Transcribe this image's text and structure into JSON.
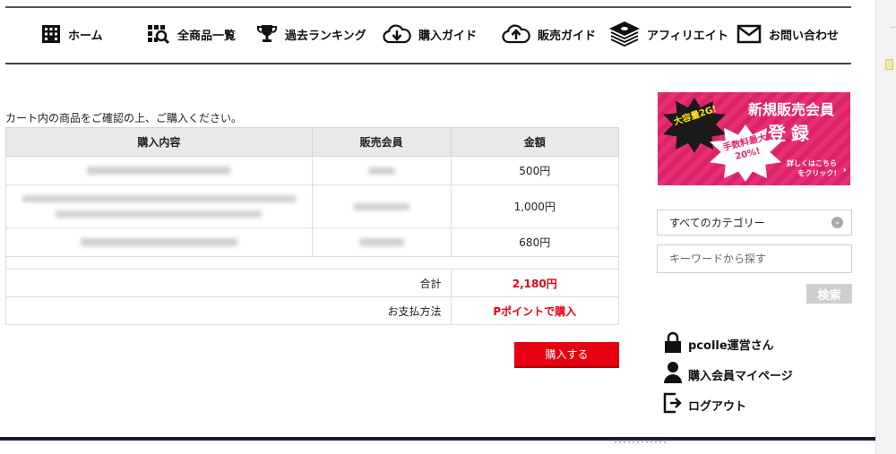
{
  "nav": {
    "items": [
      {
        "label": "ホーム",
        "icon": "building-icon"
      },
      {
        "label": "全商品一覧",
        "icon": "grid-search-icon"
      },
      {
        "label": "過去ランキング",
        "icon": "trophy-icon"
      },
      {
        "label": "購入ガイド",
        "icon": "cloud-download-icon"
      },
      {
        "label": "販売ガイド",
        "icon": "cloud-upload-icon"
      },
      {
        "label": "アフィリエイト",
        "icon": "money-stack-icon"
      },
      {
        "label": "お問い合わせ",
        "icon": "envelope-icon"
      }
    ]
  },
  "cart": {
    "intro": "カート内の商品をご確認の上、ご購入ください。",
    "headers": {
      "content": "購入内容",
      "seller": "販売会員",
      "price": "金額"
    },
    "rows": [
      {
        "price": "500円"
      },
      {
        "price": "1,000円"
      },
      {
        "price": "680円"
      }
    ],
    "total_label": "合計",
    "total_value": "2,180円",
    "payment_label": "お支払方法",
    "payment_value": "Pポイントで購入",
    "buy_button": "購入する"
  },
  "banner": {
    "burst1": "大容量2G!",
    "burst2": "手数料最大20%!",
    "title_line1": "新規販売会員",
    "title_line2": "登録",
    "sub": "詳しくはこちらをクリック!",
    "accent_color": "#e8246d"
  },
  "search": {
    "category_selected": "すべてのカテゴリー",
    "keyword_placeholder": "キーワードから探す",
    "button": "検索"
  },
  "user": {
    "name": "pcolle運営さん",
    "mypage": "購入会員マイページ",
    "logout": "ログアウト"
  },
  "colors": {
    "accent_red": "#e60012"
  }
}
